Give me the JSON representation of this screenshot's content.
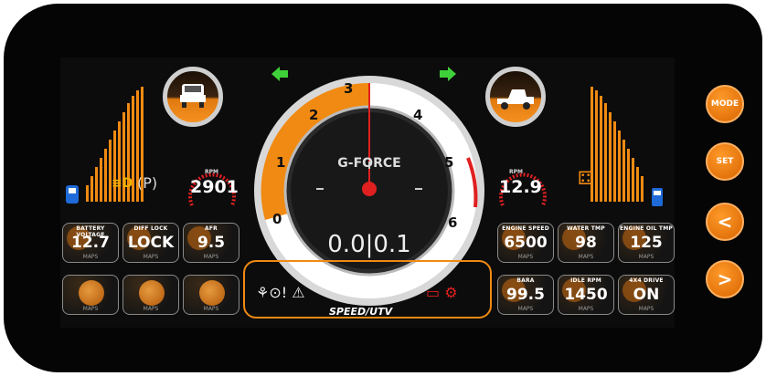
{
  "gauge": {
    "scale": [
      "0",
      "1",
      "2",
      "3",
      "4",
      "5",
      "6"
    ],
    "center_title": "G-FORCE",
    "gforce": "0.0|0.1"
  },
  "left_meter": {
    "label": "RPM",
    "value": "2901"
  },
  "right_meter": {
    "label": "RPM",
    "value": "12.9"
  },
  "left_tiles": [
    {
      "label": "BATTERY VOLTAGE",
      "value": "12.7",
      "sub": "MAPS"
    },
    {
      "label": "DIFF LOCK",
      "value": "LOCK",
      "sub": "MAPS"
    },
    {
      "label": "AFR",
      "value": "9.5",
      "sub": "MAPS"
    },
    {
      "label": "",
      "value": "",
      "sub": "MAPS"
    },
    {
      "label": "",
      "value": "",
      "sub": "MAPS"
    },
    {
      "label": "",
      "value": "",
      "sub": "MAPS"
    }
  ],
  "right_tiles": [
    {
      "label": "ENGINE SPEED",
      "value": "6500",
      "sub": "MAPS"
    },
    {
      "label": "WATER TMP",
      "value": "98",
      "sub": "MAPS"
    },
    {
      "label": "ENGINE OIL TMP",
      "value": "125",
      "sub": "MAPS"
    },
    {
      "label": "BARA",
      "value": "99.5",
      "sub": "MAPS"
    },
    {
      "label": "IDLE RPM",
      "value": "1450",
      "sub": "MAPS"
    },
    {
      "label": "4X4 DRIVE",
      "value": "ON",
      "sub": "MAPS"
    }
  ],
  "buttons": {
    "mode": "MODE",
    "set": "SET",
    "prev": "<",
    "next": ">"
  },
  "brand": "SPEED/UTV",
  "colors": {
    "accent": "#f08a12",
    "arrow": "#3fd13a",
    "warning_red": "#e02020",
    "indicator_white": "#ffffff"
  }
}
